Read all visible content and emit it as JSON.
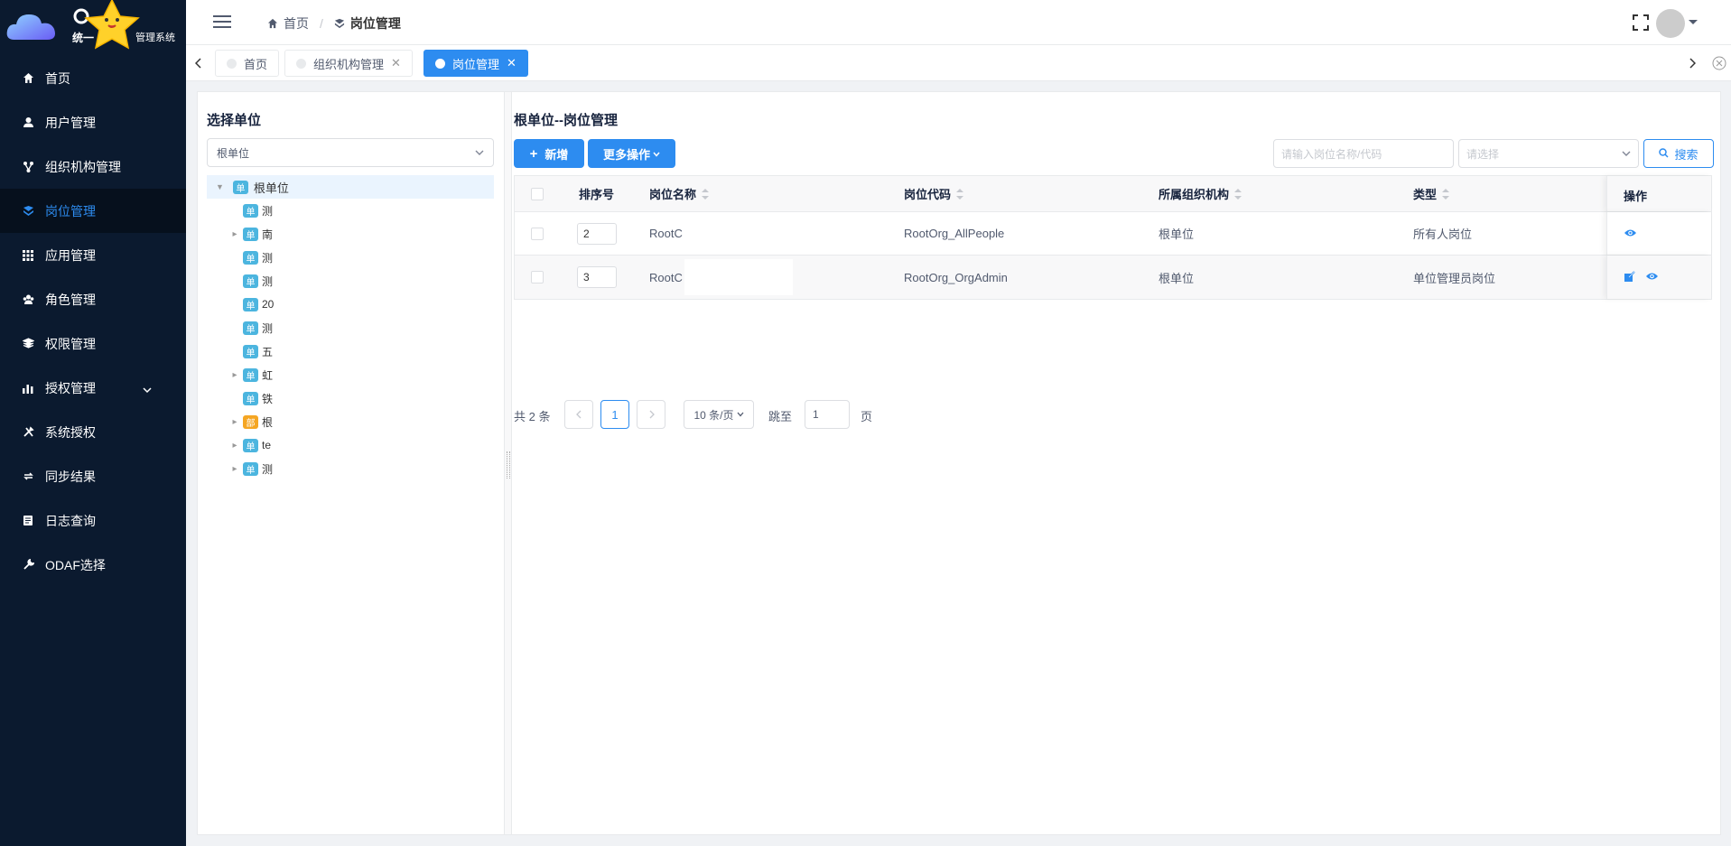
{
  "logo": {
    "title_left": "统一",
    "title_right": "管理系统"
  },
  "sidebar": {
    "items": [
      {
        "label": "首页",
        "icon": "home-icon"
      },
      {
        "label": "用户管理",
        "icon": "user-icon"
      },
      {
        "label": "组织机构管理",
        "icon": "org-icon"
      },
      {
        "label": "岗位管理",
        "icon": "position-icon",
        "active": true
      },
      {
        "label": "应用管理",
        "icon": "apps-icon"
      },
      {
        "label": "角色管理",
        "icon": "role-icon"
      },
      {
        "label": "权限管理",
        "icon": "layers-icon"
      },
      {
        "label": "授权管理",
        "icon": "chart-icon",
        "has_submenu": true
      },
      {
        "label": "系统授权",
        "icon": "tools-icon"
      },
      {
        "label": "同步结果",
        "icon": "sync-icon"
      },
      {
        "label": "日志查询",
        "icon": "log-icon"
      },
      {
        "label": "ODAF选择",
        "icon": "wrench-icon"
      }
    ]
  },
  "header": {
    "breadcrumb": [
      {
        "label": "首页",
        "icon": "home-icon"
      },
      {
        "label": "岗位管理",
        "icon": "position-icon"
      }
    ]
  },
  "tabs": [
    {
      "label": "首页",
      "active": false,
      "closable": false
    },
    {
      "label": "组织机构管理",
      "active": false,
      "closable": true
    },
    {
      "label": "岗位管理",
      "active": true,
      "closable": true
    }
  ],
  "left_panel": {
    "title": "选择单位",
    "select_value": "根单位",
    "tree": {
      "root": {
        "badge": "单",
        "label": "根单位"
      },
      "children": [
        {
          "badge": "单",
          "label": "测",
          "expandable": false
        },
        {
          "badge": "单",
          "label": "南",
          "expandable": true
        },
        {
          "badge": "单",
          "label": "测",
          "expandable": false
        },
        {
          "badge": "单",
          "label": "测",
          "expandable": false
        },
        {
          "badge": "单",
          "label": "20",
          "expandable": false
        },
        {
          "badge": "单",
          "label": "测",
          "expandable": false
        },
        {
          "badge": "单",
          "label": "五",
          "expandable": false
        },
        {
          "badge": "单",
          "label": "虹",
          "expandable": true
        },
        {
          "badge": "单",
          "label": "铁",
          "expandable": false
        },
        {
          "badge": "部",
          "label": "根",
          "expandable": true,
          "orange": true
        },
        {
          "badge": "单",
          "label": "te",
          "expandable": true
        },
        {
          "badge": "单",
          "label": "测",
          "expandable": true
        }
      ]
    }
  },
  "right_panel": {
    "title": "根单位--岗位管理",
    "add_button": "新增",
    "more_button": "更多操作",
    "search_placeholder": "请输入岗位名称/代码",
    "type_placeholder": "请选择",
    "search_button": "搜索",
    "table": {
      "headers": {
        "order": "排序号",
        "name": "岗位名称",
        "code": "岗位代码",
        "org": "所属组织机构",
        "type": "类型",
        "ops": "操作"
      },
      "rows": [
        {
          "order": "2",
          "name": "RootC",
          "code": "RootOrg_AllPeople",
          "org": "根单位",
          "type": "所有人岗位",
          "ops": [
            "view-icon"
          ]
        },
        {
          "order": "3",
          "name": "RootC",
          "code": "RootOrg_OrgAdmin",
          "org": "根单位",
          "type": "单位管理员岗位",
          "ops": [
            "edit-icon",
            "view-icon"
          ]
        }
      ]
    },
    "pager": {
      "total_text": "共 2 条",
      "current_page": "1",
      "page_size": "10 条/页",
      "jump_label": "跳至",
      "jump_value": "1",
      "page_suffix": "页"
    }
  }
}
